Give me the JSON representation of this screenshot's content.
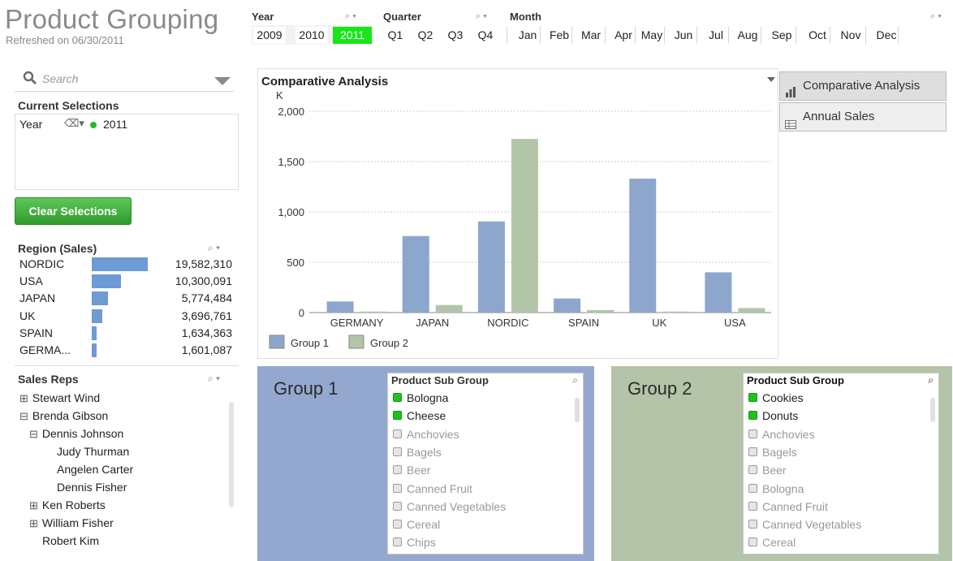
{
  "header": {
    "title": "Product Grouping",
    "refreshed": "Refreshed on 06/30/2011"
  },
  "filters": {
    "year": {
      "label": "Year",
      "values": [
        "2009",
        "2010",
        "2011"
      ],
      "selected": "2011"
    },
    "quarter": {
      "label": "Quarter",
      "values": [
        "Q1",
        "Q2",
        "Q3",
        "Q4"
      ]
    },
    "month": {
      "label": "Month",
      "values": [
        "Jan",
        "Feb",
        "Mar",
        "Apr",
        "May",
        "Jun",
        "Jul",
        "Aug",
        "Sep",
        "Oct",
        "Nov",
        "Dec"
      ]
    }
  },
  "search": {
    "placeholder": "Search"
  },
  "current_selections": {
    "title": "Current Selections",
    "field": "Year",
    "value": "2011"
  },
  "clear_button": "Clear Selections",
  "region_sales": {
    "title": "Region (Sales)",
    "rows": [
      {
        "name": "NORDIC",
        "value": "19,582,310",
        "amount": 19582310
      },
      {
        "name": "USA",
        "value": "10,300,091",
        "amount": 10300091
      },
      {
        "name": "JAPAN",
        "value": "5,774,484",
        "amount": 5774484
      },
      {
        "name": "UK",
        "value": "3,696,761",
        "amount": 3696761
      },
      {
        "name": "SPAIN",
        "value": "1,634,363",
        "amount": 1634363
      },
      {
        "name": "GERMA...",
        "value": "1,601,087",
        "amount": 1601087
      }
    ]
  },
  "sales_reps": {
    "title": "Sales Reps",
    "rows": [
      {
        "label": "Stewart Wind",
        "toggle": "⊞"
      },
      {
        "label": "Brenda Gibson",
        "toggle": "⊟"
      },
      {
        "label": "Dennis Johnson",
        "toggle": "⊟"
      },
      {
        "label": "Judy Thurman",
        "toggle": ""
      },
      {
        "label": "Angelen Carter",
        "toggle": ""
      },
      {
        "label": "Dennis Fisher",
        "toggle": ""
      },
      {
        "label": "Ken Roberts",
        "toggle": "⊞"
      },
      {
        "label": "William Fisher",
        "toggle": "⊞"
      },
      {
        "label": "Robert Kim",
        "toggle": ""
      }
    ]
  },
  "chart_tabs": [
    "Comparative Analysis",
    "Annual Sales"
  ],
  "chart_data": {
    "type": "bar",
    "title": "Comparative Analysis",
    "ylabel": "K",
    "ylim": [
      0,
      2000
    ],
    "yticks": [
      "2,000",
      "1,500",
      "1,000",
      "500",
      "0"
    ],
    "ytick_values": [
      2000,
      1500,
      1000,
      500,
      0
    ],
    "categories": [
      "GERMANY",
      "JAPAN",
      "NORDIC",
      "SPAIN",
      "UK",
      "USA"
    ],
    "series": [
      {
        "name": "Group 1",
        "color": "#8da6cc",
        "values": [
          110,
          760,
          905,
          140,
          1330,
          400
        ]
      },
      {
        "name": "Group 2",
        "color": "#b2c5a8",
        "values": [
          10,
          75,
          1725,
          25,
          10,
          45
        ]
      }
    ],
    "legend": "bottom-left"
  },
  "group1": {
    "title": "Group 1",
    "list_title": "Product Sub Group",
    "items": [
      {
        "label": "Bologna",
        "selected": true
      },
      {
        "label": "Cheese",
        "selected": true
      },
      {
        "label": "Anchovies",
        "selected": false
      },
      {
        "label": "Bagels",
        "selected": false
      },
      {
        "label": "Beer",
        "selected": false
      },
      {
        "label": "Canned Fruit",
        "selected": false
      },
      {
        "label": "Canned Vegetables",
        "selected": false
      },
      {
        "label": "Cereal",
        "selected": false
      },
      {
        "label": "Chips",
        "selected": false
      }
    ]
  },
  "group2": {
    "title": "Group 2",
    "list_title": "Product Sub Group",
    "items": [
      {
        "label": "Cookies",
        "selected": true
      },
      {
        "label": "Donuts",
        "selected": true
      },
      {
        "label": "Anchovies",
        "selected": false
      },
      {
        "label": "Bagels",
        "selected": false
      },
      {
        "label": "Beer",
        "selected": false
      },
      {
        "label": "Bologna",
        "selected": false
      },
      {
        "label": "Canned Fruit",
        "selected": false
      },
      {
        "label": "Canned Vegetables",
        "selected": false
      },
      {
        "label": "Cereal",
        "selected": false
      }
    ]
  }
}
